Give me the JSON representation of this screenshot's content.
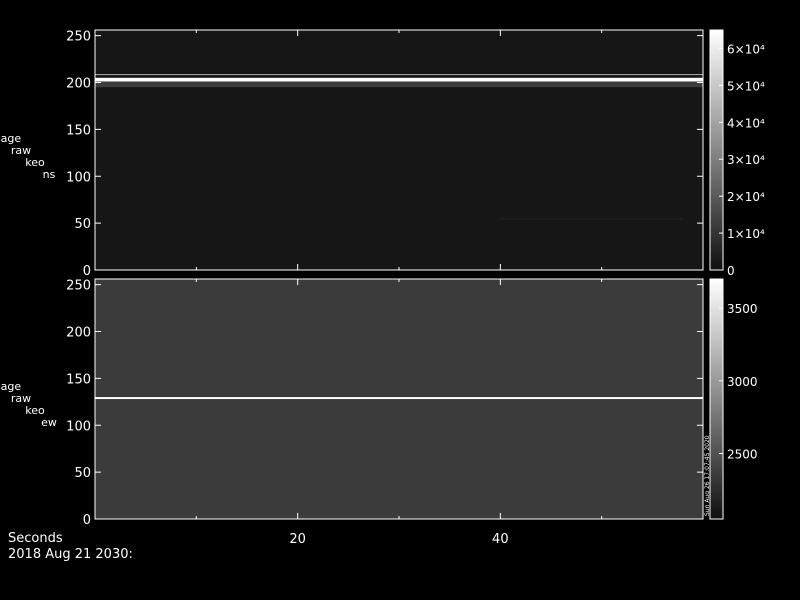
{
  "chart_data": [
    {
      "type": "heatmap",
      "panel": "top",
      "ylabel_lines": [
        "image",
        "raw",
        "keo",
        "ns"
      ],
      "ylim": [
        0,
        256
      ],
      "yticks": [
        0,
        50,
        100,
        150,
        200,
        250
      ],
      "xlim": [
        0,
        60
      ],
      "background_level": 1500,
      "features": [
        {
          "kind": "bright_band",
          "y_start": 201,
          "y_end": 205,
          "level": 65000
        },
        {
          "kind": "bright_band",
          "y_start": 208,
          "y_end": 209,
          "level": 42000
        },
        {
          "kind": "faint_band",
          "y_start": 195,
          "y_end": 201,
          "level": 12000
        },
        {
          "kind": "faint_streak",
          "y": 55,
          "x_start": 40,
          "x_end": 58,
          "level": 6000
        }
      ],
      "colorbar": {
        "range": [
          0,
          65000
        ],
        "ticks": [
          {
            "value": 0,
            "label": "0"
          },
          {
            "value": 10000,
            "label": "1×10⁴"
          },
          {
            "value": 20000,
            "label": "2×10⁴"
          },
          {
            "value": 30000,
            "label": "3×10⁴"
          },
          {
            "value": 40000,
            "label": "4×10⁴"
          },
          {
            "value": 50000,
            "label": "5×10⁴"
          },
          {
            "value": 60000,
            "label": "6×10⁴"
          }
        ]
      }
    },
    {
      "type": "heatmap",
      "panel": "bottom",
      "ylabel_lines": [
        "image",
        "raw",
        "keo",
        "ew"
      ],
      "ylim": [
        0,
        256
      ],
      "yticks": [
        0,
        50,
        100,
        150,
        200,
        250
      ],
      "xlim": [
        0,
        60
      ],
      "xticks": [
        20,
        40
      ],
      "background_level": 2350,
      "features": [
        {
          "kind": "bright_line",
          "y": 129,
          "level": 3700
        }
      ],
      "colorbar": {
        "range": [
          2050,
          3700
        ],
        "ticks": [
          {
            "value": 2500,
            "label": "2500"
          },
          {
            "value": 3000,
            "label": "3000"
          },
          {
            "value": 3500,
            "label": "3500"
          }
        ]
      }
    }
  ],
  "footer": {
    "xunit": "Seconds",
    "timestamp": "2018 Aug 21 2030:"
  },
  "side_note": "Sun Aug 26 17:07:45 2020",
  "colors": {
    "background": "#000000",
    "axis": "#ffffff",
    "image_dark": "#101010",
    "image_bright": "#ffffff"
  }
}
